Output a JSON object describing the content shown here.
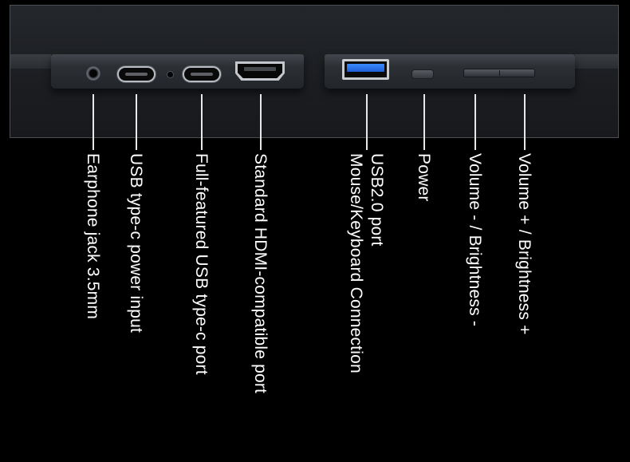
{
  "labels": {
    "earphone": "Earphone jack 3.5mm",
    "typec_power": "USB type-c power input",
    "typec_full": "Full-featured USB type-c port",
    "hdmi": "Standard HDMI-compatible port",
    "usb2_line1": "USB2.0 port",
    "usb2_line2": "Mouse/Keyboard Connection",
    "power": "Power",
    "volume_down": "Volume - / Brightness -",
    "volume_up": "Volume + / Brightness +"
  },
  "colors": {
    "usb_tongue": "#2f7bf5",
    "background": "#000000"
  }
}
